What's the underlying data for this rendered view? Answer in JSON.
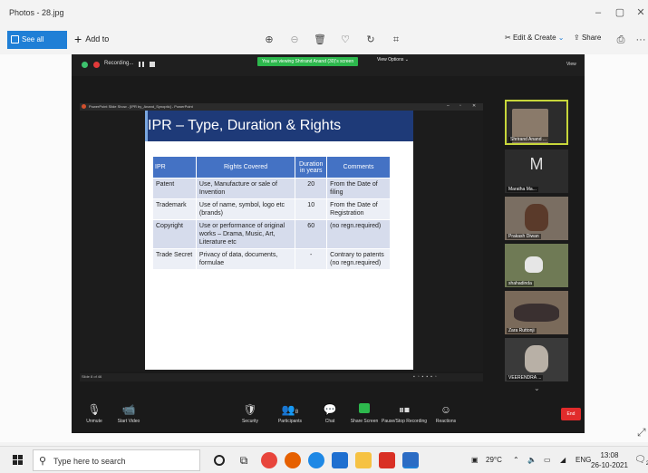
{
  "window": {
    "title": "Photos - 28.jpg",
    "controls": [
      "–",
      "▢",
      "✕"
    ]
  },
  "toolbar": {
    "see_all": "See all photos",
    "add_to": "Add to",
    "edit_create": "Edit & Create",
    "share": "Share",
    "more": "···"
  },
  "zoom": {
    "recording_label": "Recording...",
    "viewing_banner": "You are viewing Shrirand Anand (30)'s screen",
    "view_options": "View Options ⌄",
    "view_button": "View",
    "ppt_title": "PowerPoint Slide Show - [IPR by_Anand_Synoptic] - PowerPoint",
    "slide_counter": "Slide 8 of 46",
    "slide": {
      "title": "IPR – Type, Duration & Rights",
      "headers": [
        "IPR",
        "Rights Covered",
        "Duration in years",
        "Comments"
      ],
      "rows": [
        {
          "ipr": "Patent",
          "rights": "Use, Manufacture or sale of Invention",
          "duration": "20",
          "comments": "From the Date of filing"
        },
        {
          "ipr": "Trademark",
          "rights": "Use of name, symbol, logo etc (brands)",
          "duration": "10",
          "comments": "From the Date of Registration"
        },
        {
          "ipr": "Copyright",
          "rights": "Use or performance of original works – Drama, Music, Art, Literature etc",
          "duration": "60",
          "comments": "(no regn.required)"
        },
        {
          "ipr": "Trade Secret",
          "rights": "Privacy of data, documents, formulae",
          "duration": "-",
          "comments": "Contrary to patents (no regn.required)"
        }
      ]
    },
    "participants": [
      {
        "name": "Shrirand Anand ...",
        "kind": "video"
      },
      {
        "name": "Maratha Ma...",
        "initial": "M",
        "kind": "initial"
      },
      {
        "name": "Prakash Diwan",
        "kind": "video"
      },
      {
        "name": "shahadinda",
        "kind": "video"
      },
      {
        "name": "Zara Ruttonji",
        "kind": "video"
      },
      {
        "name": "VEERENDRA ...",
        "kind": "video"
      }
    ],
    "controls": {
      "unmute": "Unmute",
      "start_video": "Start Video",
      "security": "Security",
      "participants": "Participants",
      "participants_count": "8",
      "chat": "Chat",
      "share_screen": "Share Screen",
      "record": "Pause/Stop Recording",
      "reactions": "Reactions",
      "end": "End"
    }
  },
  "taskbar": {
    "search_placeholder": "Type here to search",
    "weather": "29°C",
    "lang": "ENG",
    "time": "13:08",
    "date": "26-10-2021",
    "notif_count": "2"
  },
  "colors": {
    "slide_banner": "#1e3a78",
    "table_header": "#4472c4",
    "share_green": "#2db84d",
    "end_red": "#e12b2b",
    "photos_accent": "#1f7fd6"
  }
}
